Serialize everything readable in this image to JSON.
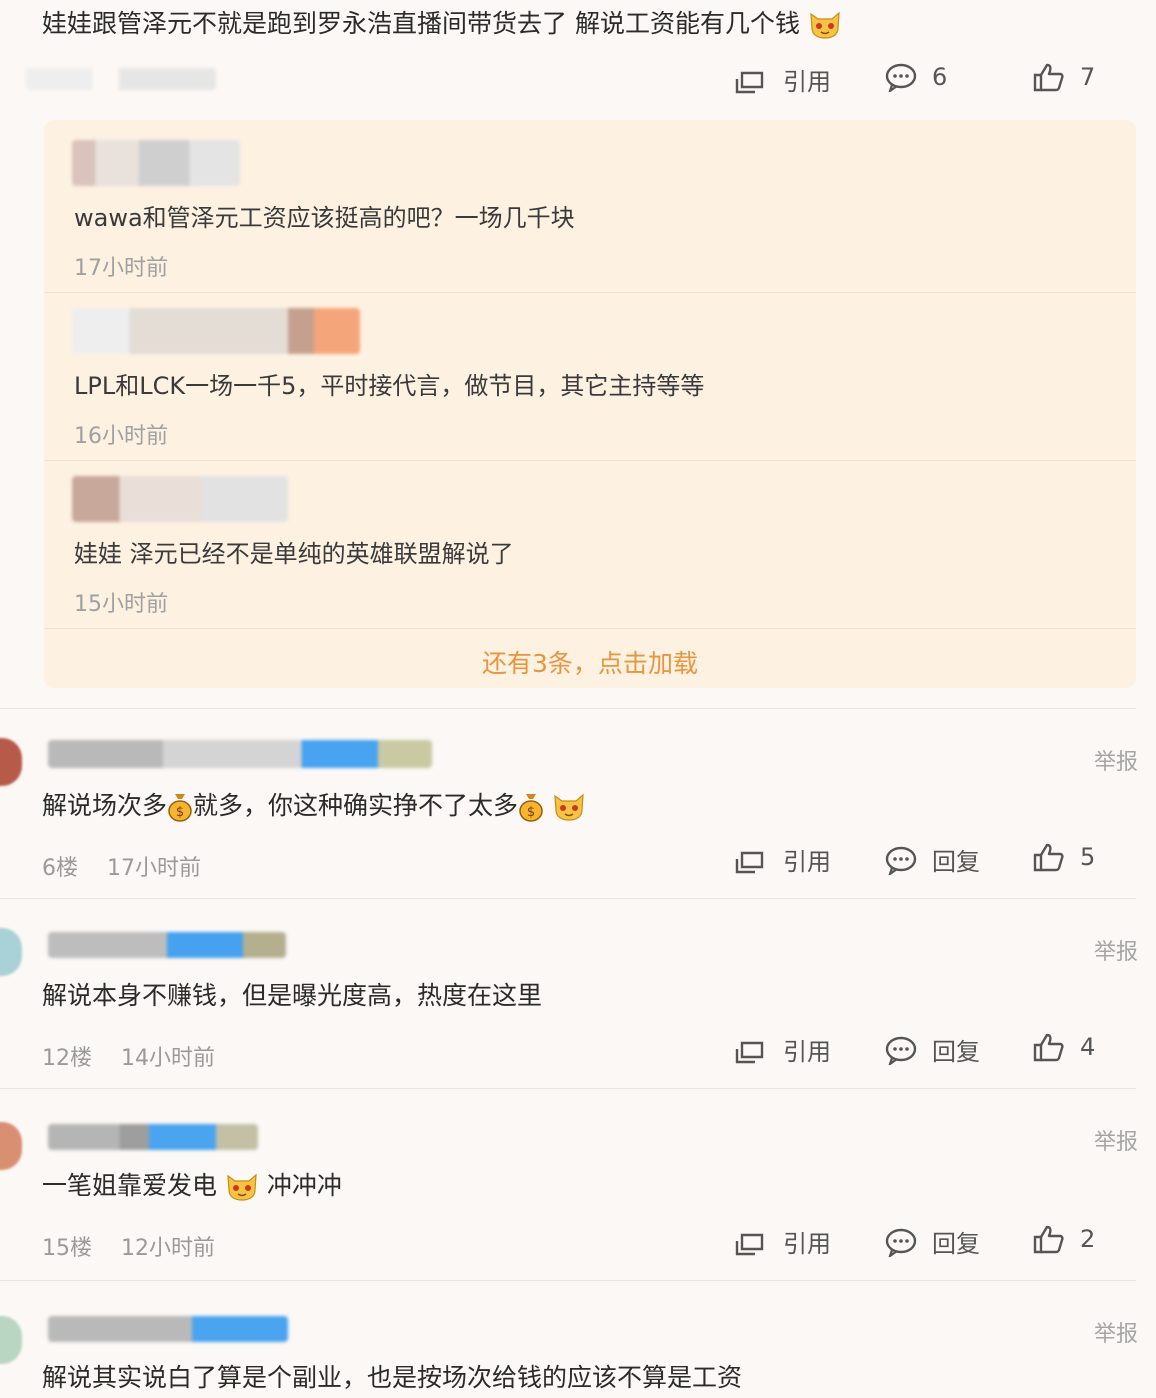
{
  "top_comment": {
    "text": "娃娃跟管泽元不就是跑到罗永浩直播间带货去了 解说工资能有几个钱",
    "actions": {
      "quote": "引用",
      "comments": "6",
      "likes": "7"
    }
  },
  "replies": [
    {
      "text": "wawa和管泽元工资应该挺高的吧？一场几千块",
      "time": "17小时前"
    },
    {
      "text": "LPL和LCK一场一千5，平时接代言，做节目，其它主持等等",
      "time": "16小时前"
    },
    {
      "text": "娃娃 泽元已经不是单纯的英雄联盟解说了",
      "time": "15小时前"
    }
  ],
  "load_more": "还有3条，点击加载",
  "comments": [
    {
      "text_a": "解说场次多",
      "text_b": "就多，你这种确实挣不了太多",
      "floor": "6楼",
      "time": "17小时前",
      "quote": "引用",
      "reply": "回复",
      "likes": "5",
      "report": "举报"
    },
    {
      "text": "解说本身不赚钱，但是曝光度高，热度在这里",
      "floor": "12楼",
      "time": "14小时前",
      "quote": "引用",
      "reply": "回复",
      "likes": "4",
      "report": "举报"
    },
    {
      "text_a": "一笔姐靠爱发电",
      "text_b": "冲冲冲",
      "floor": "15楼",
      "time": "12小时前",
      "quote": "引用",
      "reply": "回复",
      "likes": "2",
      "report": "举报"
    },
    {
      "text": "解说其实说白了算是个副业，也是按场次给钱的应该不算是工资",
      "report": "举报"
    }
  ],
  "icons": {
    "quote": "quote-icon",
    "comment": "comment-icon",
    "like": "thumbs-up-icon",
    "emoji_cat": "cat-face-emoji",
    "emoji_money": "money-bag-emoji"
  },
  "colors": {
    "accent": "#e8953e",
    "reply_bg": "#fdf1e2",
    "page_bg": "#fbf8f5",
    "meta": "#9a9a9a"
  }
}
